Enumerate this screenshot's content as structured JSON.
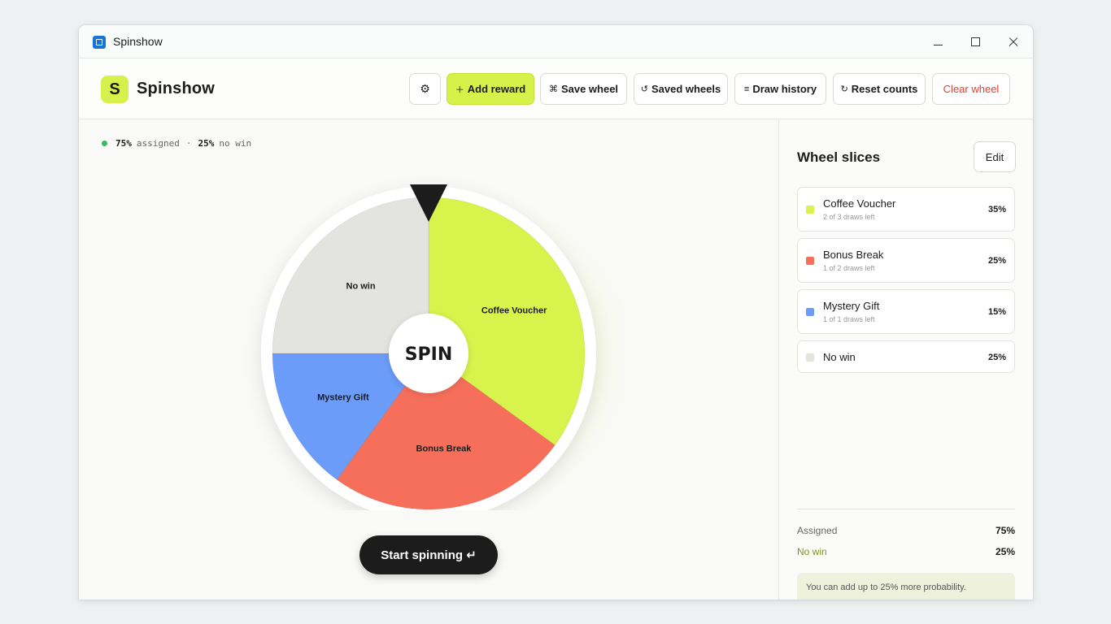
{
  "window": {
    "title": "Spinshow"
  },
  "header": {
    "logo_letter": "S",
    "brand": "Spinshow",
    "buttons": {
      "settings_icon": "⚙",
      "add_reward": "Add reward",
      "save_wheel": "Save wheel",
      "saved_wheels": "Saved wheels",
      "draw_history": "Draw history",
      "reset_counts": "Reset counts",
      "clear_wheel": "Clear wheel"
    }
  },
  "status": {
    "assigned_pct": "75%",
    "assigned_label": "assigned",
    "separator": "·",
    "nowin_pct": "25%",
    "nowin_label": "no win"
  },
  "wheel": {
    "center_label": "SPIN",
    "slices": [
      {
        "label": "Coffee Voucher",
        "percent": 35,
        "color": "#d7f34c"
      },
      {
        "label": "Bonus Break",
        "percent": 25,
        "color": "#f66f5b"
      },
      {
        "label": "Mystery Gift",
        "percent": 15,
        "color": "#6b9cf9"
      },
      {
        "label": "No win",
        "percent": 25,
        "color": "#e3e3df"
      }
    ]
  },
  "start_button": "Start spinning ↵",
  "panel": {
    "title": "Wheel slices",
    "edit": "Edit",
    "items": [
      {
        "name": "Coffee Voucher",
        "sub": "2 of 3 draws left",
        "pct": "35%",
        "color": "#d7f34c"
      },
      {
        "name": "Bonus Break",
        "sub": "1 of 2 draws left",
        "pct": "25%",
        "color": "#f66f5b"
      },
      {
        "name": "Mystery Gift",
        "sub": "1 of 1 draws left",
        "pct": "15%",
        "color": "#6b9cf9"
      },
      {
        "name": "No win",
        "sub": "",
        "pct": "25%",
        "color": "#e3e3df"
      }
    ],
    "summary": {
      "assigned_label": "Assigned",
      "assigned_value": "75%",
      "nowin_label": "No win",
      "nowin_value": "25%"
    },
    "note": "You can add up to 25% more probability."
  }
}
